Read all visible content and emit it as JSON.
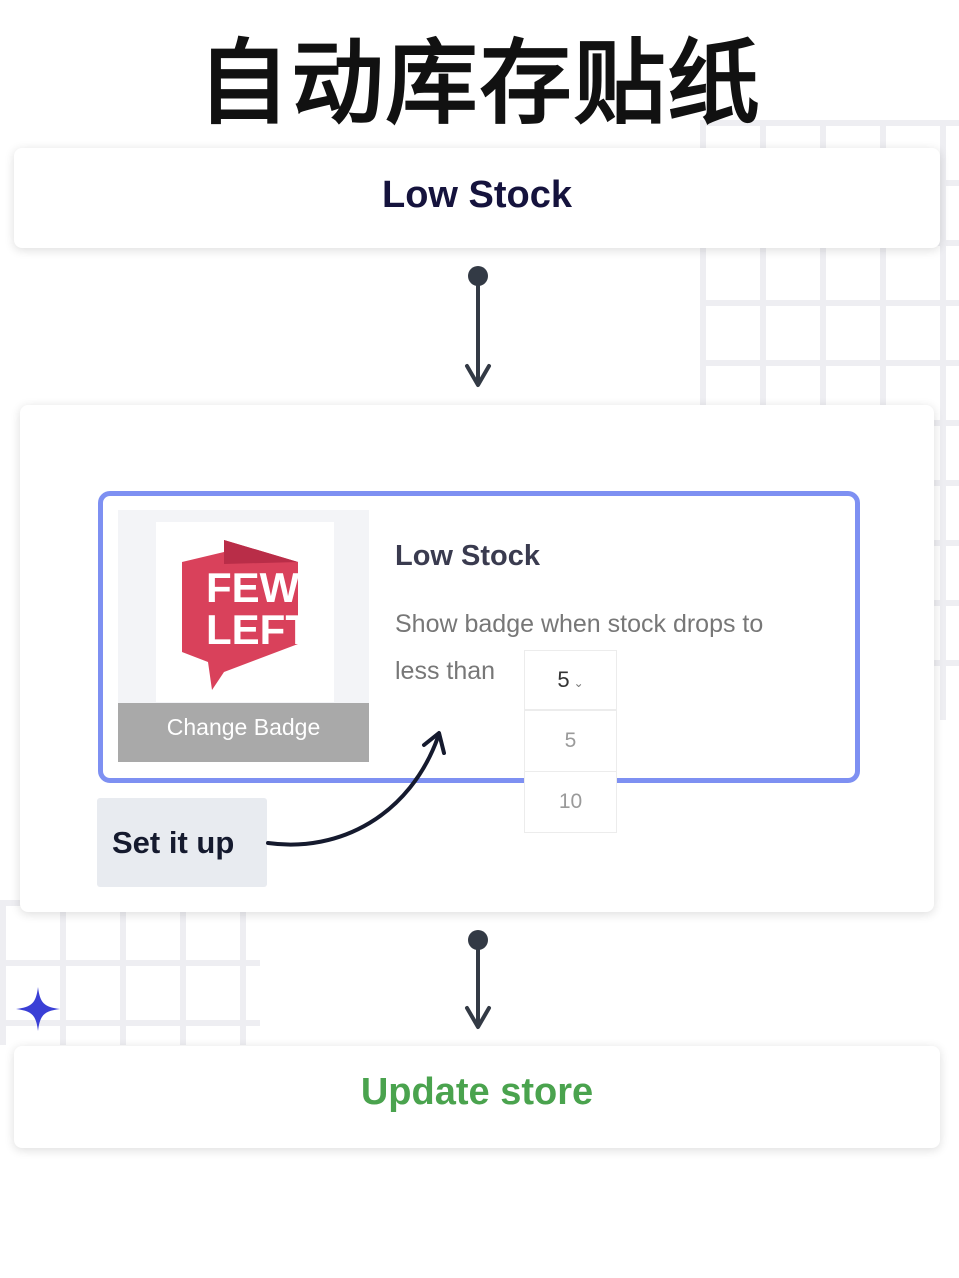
{
  "title": "自动库存贴纸",
  "top_card": {
    "label": "Low Stock"
  },
  "badge_card": {
    "badge_line1": "FEW",
    "badge_line2": "LEFT",
    "change_badge_label": "Change Badge",
    "panel_title": "Low Stock",
    "description_line1": "Show badge when stock drops to",
    "description_line2": "less than",
    "dropdown": {
      "selected": "5",
      "options": [
        "5",
        "10"
      ]
    }
  },
  "callout": {
    "label": "Set it up"
  },
  "bottom_card": {
    "label": "Update store"
  },
  "colors": {
    "accent": "#7e90f2",
    "badge_red": "#d9415b",
    "update_green": "#4aa34e",
    "connector": "#333a45",
    "sparkle": "#3a3fd6"
  },
  "icons": {
    "connector": "arrow-down-icon",
    "sparkle": "sparkle-icon",
    "dropdown": "chevron-down-icon"
  }
}
